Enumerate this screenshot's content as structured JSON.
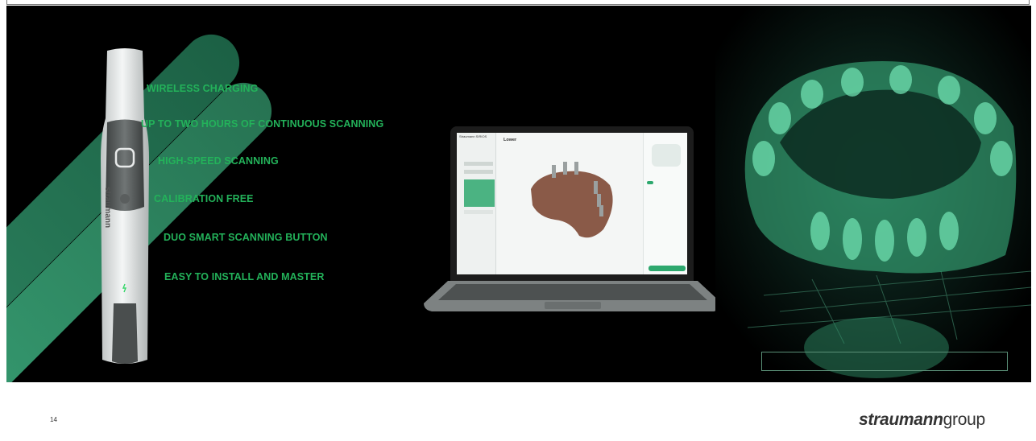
{
  "features": [
    "WIRELESS CHARGING",
    "UP TO TWO HOURS OF CONTINUOUS SCANNING",
    "HIGH-SPEED SCANNING",
    "CALIBRATION FREE",
    "DUO SMART SCANNING BUTTON",
    "EASY TO INSTALL AND MASTER"
  ],
  "scanner_brand": "straumann",
  "app": {
    "title": "Straumann SIRIOS",
    "view_label": "Lower"
  },
  "footer": {
    "page_number": "14",
    "logo_bold": "straumann",
    "logo_light": "group"
  },
  "colors": {
    "accent": "#23b25a",
    "background": "#000000"
  }
}
